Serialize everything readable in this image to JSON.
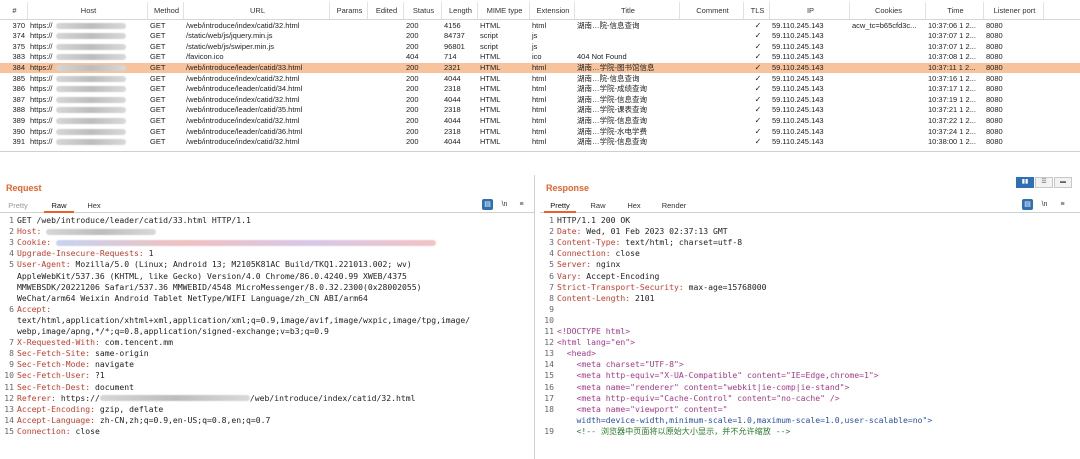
{
  "history": {
    "columns": [
      "#",
      "Host",
      "Method",
      "URL",
      "Params",
      "Edited",
      "Status",
      "Length",
      "MIME type",
      "Extension",
      "Title",
      "Comment",
      "TLS",
      "IP",
      "Cookies",
      "Time",
      "Listener port"
    ],
    "rows": [
      {
        "id": "370",
        "host": "https://",
        "method": "GET",
        "url": "/web/introduce/index/catid/32.html",
        "status": "200",
        "length": "4156",
        "mime": "HTML",
        "ext": "html",
        "title": "湖南…院-信息查询",
        "tls": "✓",
        "ip": "59.110.245.143",
        "cookies": "acw_tc=b65cfd3c...",
        "time": "10:37:06 1 2...",
        "port": "8080"
      },
      {
        "id": "374",
        "host": "https://",
        "method": "GET",
        "url": "/static/web/js/jquery.min.js",
        "status": "200",
        "length": "84737",
        "mime": "script",
        "ext": "js",
        "title": "",
        "tls": "✓",
        "ip": "59.110.245.143",
        "cookies": "",
        "time": "10:37:07 1 2...",
        "port": "8080"
      },
      {
        "id": "375",
        "host": "https://",
        "method": "GET",
        "url": "/static/web/js/swiper.min.js",
        "status": "200",
        "length": "96801",
        "mime": "script",
        "ext": "js",
        "title": "",
        "tls": "✓",
        "ip": "59.110.245.143",
        "cookies": "",
        "time": "10:37:07 1 2...",
        "port": "8080"
      },
      {
        "id": "383",
        "host": "https://",
        "method": "GET",
        "url": "/favicon.ico",
        "status": "404",
        "length": "714",
        "mime": "HTML",
        "ext": "ico",
        "title": "404 Not Found",
        "tls": "✓",
        "ip": "59.110.245.143",
        "cookies": "",
        "time": "10:37:08 1 2...",
        "port": "8080"
      },
      {
        "id": "384",
        "host": "https://",
        "method": "GET",
        "url": "/web/introduce/leader/catid/33.html",
        "status": "200",
        "length": "2321",
        "mime": "HTML",
        "ext": "html",
        "title": "湖南…学院-图书馆信息",
        "tls": "✓",
        "ip": "59.110.245.143",
        "cookies": "",
        "time": "10:37:11 1 2...",
        "port": "8080"
      },
      {
        "id": "385",
        "host": "https://",
        "method": "GET",
        "url": "/web/introduce/index/catid/32.html",
        "status": "200",
        "length": "4044",
        "mime": "HTML",
        "ext": "html",
        "title": "湖南…院-信息查询",
        "tls": "✓",
        "ip": "59.110.245.143",
        "cookies": "",
        "time": "10:37:16 1 2...",
        "port": "8080"
      },
      {
        "id": "386",
        "host": "https://",
        "method": "GET",
        "url": "/web/introduce/leader/catid/34.html",
        "status": "200",
        "length": "2318",
        "mime": "HTML",
        "ext": "html",
        "title": "湖南…学院-成绩查询",
        "tls": "✓",
        "ip": "59.110.245.143",
        "cookies": "",
        "time": "10:37:17 1 2...",
        "port": "8080"
      },
      {
        "id": "387",
        "host": "https://",
        "method": "GET",
        "url": "/web/introduce/index/catid/32.html",
        "status": "200",
        "length": "4044",
        "mime": "HTML",
        "ext": "html",
        "title": "湖南…学院-信息查询",
        "tls": "✓",
        "ip": "59.110.245.143",
        "cookies": "",
        "time": "10:37:19 1 2...",
        "port": "8080"
      },
      {
        "id": "388",
        "host": "https://",
        "method": "GET",
        "url": "/web/introduce/leader/catid/35.html",
        "status": "200",
        "length": "2318",
        "mime": "HTML",
        "ext": "html",
        "title": "湖南…学院-课表查询",
        "tls": "✓",
        "ip": "59.110.245.143",
        "cookies": "",
        "time": "10:37:21 1 2...",
        "port": "8080"
      },
      {
        "id": "389",
        "host": "https://",
        "method": "GET",
        "url": "/web/introduce/index/catid/32.html",
        "status": "200",
        "length": "4044",
        "mime": "HTML",
        "ext": "html",
        "title": "湖南…学院-信息查询",
        "tls": "✓",
        "ip": "59.110.245.143",
        "cookies": "",
        "time": "10:37:22 1 2...",
        "port": "8080"
      },
      {
        "id": "390",
        "host": "https://",
        "method": "GET",
        "url": "/web/introduce/leader/catid/36.html",
        "status": "200",
        "length": "2318",
        "mime": "HTML",
        "ext": "html",
        "title": "湖南…学院-水电学费",
        "tls": "✓",
        "ip": "59.110.245.143",
        "cookies": "",
        "time": "10:37:24 1 2...",
        "port": "8080"
      },
      {
        "id": "391",
        "host": "https://",
        "method": "GET",
        "url": "/web/introduce/index/catid/32.html",
        "status": "200",
        "length": "4044",
        "mime": "HTML",
        "ext": "html",
        "title": "湖南…学院-信息查询",
        "tls": "✓",
        "ip": "59.110.245.143",
        "cookies": "",
        "time": "10:38:00 1 2...",
        "port": "8080"
      }
    ],
    "selected_id": "384",
    "selected_color": "#f6c39c"
  },
  "request": {
    "title": "Request",
    "tabs": [
      "Pretty",
      "Raw",
      "Hex"
    ],
    "active_tab": "Raw",
    "icons": [
      "wrap-icon",
      "newline-icon",
      "menu-icon"
    ],
    "newline_label": "\\n",
    "menu_label": "≡",
    "lines": [
      {
        "n": "1",
        "k": "",
        "v": "GET /web/introduce/leader/catid/33.html HTTP/1.1"
      },
      {
        "n": "2",
        "k": "Host:",
        "v": " "
      },
      {
        "n": "3",
        "k": "Cookie:",
        "v": " "
      },
      {
        "n": "4",
        "k": "Upgrade-Insecure-Requests:",
        "v": " 1"
      },
      {
        "n": "5",
        "k": "User-Agent:",
        "v": " Mozilla/5.0 (Linux; Android 13; M2105K81AC Build/TKQ1.221013.002; wv)"
      },
      {
        "n": "",
        "k": "",
        "v": "AppleWebKit/537.36 (KHTML, like Gecko) Version/4.0 Chrome/86.0.4240.99 XWEB/4375"
      },
      {
        "n": "",
        "k": "",
        "v": "MMWEBSDK/20221206 Safari/537.36 MMWEBID/4548 MicroMessenger/8.0.32.2300(0x28002055)"
      },
      {
        "n": "",
        "k": "",
        "v": "WeChat/arm64 Weixin Android Tablet NetType/WIFI Language/zh_CN ABI/arm64"
      },
      {
        "n": "6",
        "k": "Accept:",
        "v": ""
      },
      {
        "n": "",
        "k": "",
        "v": "text/html,application/xhtml+xml,application/xml;q=0.9,image/avif,image/wxpic,image/tpg,image/"
      },
      {
        "n": "",
        "k": "",
        "v": "webp,image/apng,*/*;q=0.8,application/signed-exchange;v=b3;q=0.9"
      },
      {
        "n": "7",
        "k": "X-Requested-With:",
        "v": " com.tencent.mm"
      },
      {
        "n": "8",
        "k": "Sec-Fetch-Site:",
        "v": " same-origin"
      },
      {
        "n": "9",
        "k": "Sec-Fetch-Mode:",
        "v": " navigate"
      },
      {
        "n": "10",
        "k": "Sec-Fetch-User:",
        "v": " ?1"
      },
      {
        "n": "11",
        "k": "Sec-Fetch-Dest:",
        "v": " document"
      },
      {
        "n": "12",
        "k": "Referer:",
        "v": " https://"
      },
      {
        "n": "13",
        "k": "Accept-Encoding:",
        "v": " gzip, deflate"
      },
      {
        "n": "14",
        "k": "Accept-Language:",
        "v": " zh-CN,zh;q=0.9,en-US;q=0.8,en;q=0.7"
      },
      {
        "n": "15",
        "k": "Connection:",
        "v": " close"
      }
    ],
    "referer_suffix": "/web/introduce/index/catid/32.html"
  },
  "response": {
    "title": "Response",
    "tabs": [
      "Pretty",
      "Raw",
      "Hex",
      "Render"
    ],
    "active_tab": "Pretty",
    "icons": [
      "wrap-icon",
      "newline-icon",
      "menu-icon"
    ],
    "newline_label": "\\n",
    "menu_label": "≡",
    "layout_buttons": [
      "split-horizontal-icon",
      "split-vertical-icon",
      "single-pane-icon"
    ],
    "lines": [
      {
        "n": "1",
        "text": "HTTP/1.1 200 OK",
        "type": "plain"
      },
      {
        "n": "2",
        "k": "Date:",
        "v": " Wed, 01 Feb 2023 02:37:13 GMT",
        "type": "header"
      },
      {
        "n": "3",
        "k": "Content-Type:",
        "v": " text/html; charset=utf-8",
        "type": "header"
      },
      {
        "n": "4",
        "k": "Connection:",
        "v": " close",
        "type": "header"
      },
      {
        "n": "5",
        "k": "Server:",
        "v": " nginx",
        "type": "header"
      },
      {
        "n": "6",
        "k": "Vary:",
        "v": " Accept-Encoding",
        "type": "header"
      },
      {
        "n": "7",
        "k": "Strict-Transport-Security:",
        "v": " max-age=15768000",
        "type": "header"
      },
      {
        "n": "8",
        "k": "Content-Length:",
        "v": " 2101",
        "type": "header"
      },
      {
        "n": "9",
        "text": "",
        "type": "plain"
      },
      {
        "n": "10",
        "text": "",
        "type": "plain"
      },
      {
        "n": "11",
        "text": "<!DOCTYPE html>",
        "type": "tag"
      },
      {
        "n": "12",
        "text": "<html lang=\"en\">",
        "type": "tag"
      },
      {
        "n": "13",
        "text": "  <head>",
        "type": "tag"
      },
      {
        "n": "14",
        "text": "    <meta charset=\"UTF-8\">",
        "type": "tag"
      },
      {
        "n": "15",
        "text": "    <meta http-equiv=\"X-UA-Compatible\" content=\"IE=Edge,chrome=1\">",
        "type": "tag"
      },
      {
        "n": "16",
        "text": "    <meta name=\"renderer\" content=\"webkit|ie-comp|ie-stand\">",
        "type": "tag"
      },
      {
        "n": "17",
        "text": "    <meta http-equiv=\"Cache-Control\" content=\"no-cache\" />",
        "type": "tag"
      },
      {
        "n": "18",
        "text": "    <meta name=\"viewport\" content=\"",
        "type": "tag"
      },
      {
        "n": "",
        "text": "    width=device-width,minimum-scale=1.0,maximum-scale=1.0,user-scalable=no\">",
        "type": "sval"
      },
      {
        "n": "19",
        "text": "    <!-- 浏览器中页面将以原始大小显示，并不允许缩放 -->",
        "type": "comment"
      }
    ]
  }
}
